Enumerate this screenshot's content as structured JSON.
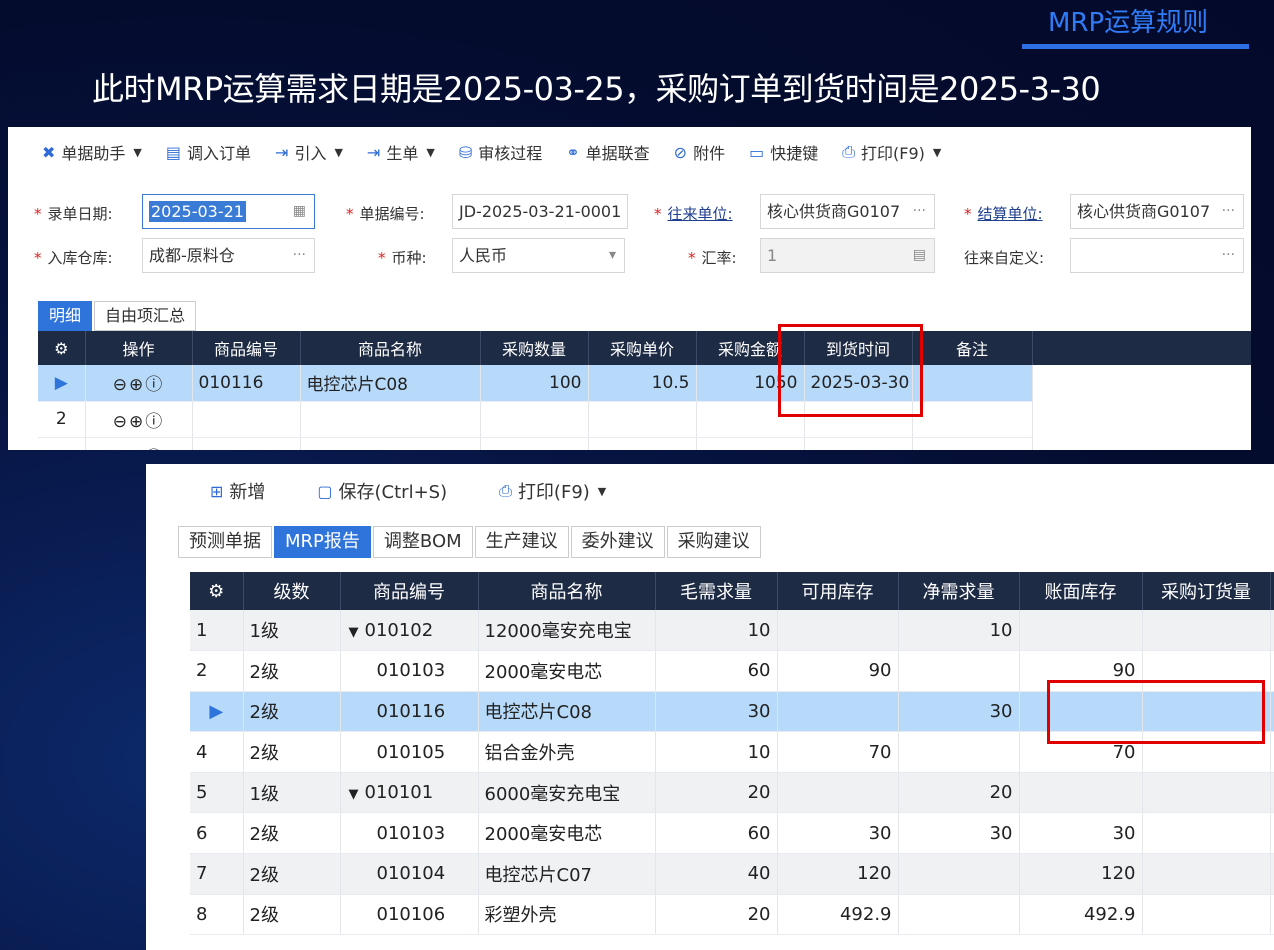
{
  "slide": {
    "title": "MRP运算规则",
    "subtitle": "此时MRP运算需求日期是2025-03-25，采购订单到货时间是2025-3-30"
  },
  "order_form": {
    "toolbar": [
      {
        "label": "单据助手",
        "icon": "✖",
        "caret": true
      },
      {
        "label": "调入订单",
        "icon": "▤",
        "caret": false
      },
      {
        "label": "引入",
        "icon": "⇥",
        "caret": true
      },
      {
        "label": "生单",
        "icon": "⇥",
        "caret": true
      },
      {
        "label": "审核过程",
        "icon": "⛁",
        "caret": false
      },
      {
        "label": "单据联查",
        "icon": "⚭",
        "caret": false
      },
      {
        "label": "附件",
        "icon": "⊘",
        "caret": false
      },
      {
        "label": "快捷键",
        "icon": "▭",
        "caret": false
      },
      {
        "label": "打印(F9)",
        "icon": "⎙",
        "caret": true
      }
    ],
    "fields": {
      "entry_date_label": "录单日期:",
      "entry_date_value": "2025-03-21",
      "doc_no_label": "单据编号:",
      "doc_no_value": "JD-2025-03-21-0001",
      "partner_label": "往来单位:",
      "partner_value": "核心供货商G0107",
      "settle_label": "结算单位:",
      "settle_value": "核心供货商G0107",
      "warehouse_label": "入库仓库:",
      "warehouse_value": "成都-原料仓",
      "currency_label": "币种:",
      "currency_value": "人民币",
      "rate_label": "汇率:",
      "rate_value": "1",
      "custom_label": "往来自定义:",
      "custom_value": ""
    },
    "tabs": [
      "明细",
      "自由项汇总"
    ],
    "columns": [
      "操作",
      "商品编号",
      "商品名称",
      "采购数量",
      "采购单价",
      "采购金额",
      "到货时间",
      "备注"
    ],
    "rows": [
      {
        "idx": "▶",
        "ops": "⊖⊕ⓘ",
        "code": "010116",
        "name": "电控芯片C08",
        "qty": "100",
        "price": "10.5",
        "amount": "1050",
        "arrival": "2025-03-30",
        "note": ""
      },
      {
        "idx": "2",
        "ops": "⊖⊕ⓘ",
        "code": "",
        "name": "",
        "qty": "",
        "price": "",
        "amount": "",
        "arrival": "",
        "note": ""
      },
      {
        "idx": "",
        "ops": "⊖⊕ⓘ",
        "code": "",
        "name": "",
        "qty": "",
        "price": "",
        "amount": "",
        "arrival": "",
        "note": ""
      }
    ]
  },
  "mrp": {
    "toolbar": [
      {
        "label": "新增",
        "icon": "⊞",
        "caret": false
      },
      {
        "label": "保存(Ctrl+S)",
        "icon": "▢",
        "caret": false
      },
      {
        "label": "打印(F9)",
        "icon": "⎙",
        "caret": true
      }
    ],
    "tabs": [
      "预测单据",
      "MRP报告",
      "调整BOM",
      "生产建议",
      "委外建议",
      "采购建议"
    ],
    "active_tab": 1,
    "columns": [
      "级数",
      "商品编号",
      "商品名称",
      "毛需求量",
      "可用库存",
      "净需求量",
      "账面库存",
      "采购订货量"
    ],
    "rows": [
      {
        "idx": "1",
        "level": "1级",
        "expand": "▼",
        "code": "010102",
        "name": "12000毫安充电宝",
        "gross": "10",
        "avail": "",
        "net": "10",
        "book": "",
        "po": ""
      },
      {
        "idx": "2",
        "level": "2级",
        "expand": "",
        "code": "010103",
        "name": "2000毫安电芯",
        "gross": "60",
        "avail": "90",
        "net": "",
        "book": "90",
        "po": ""
      },
      {
        "idx": "▶",
        "level": "2级",
        "expand": "",
        "code": "010116",
        "name": "电控芯片C08",
        "gross": "30",
        "avail": "",
        "net": "30",
        "book": "",
        "po": ""
      },
      {
        "idx": "4",
        "level": "2级",
        "expand": "",
        "code": "010105",
        "name": "铝合金外壳",
        "gross": "10",
        "avail": "70",
        "net": "",
        "book": "70",
        "po": ""
      },
      {
        "idx": "5",
        "level": "1级",
        "expand": "▼",
        "code": "010101",
        "name": "6000毫安充电宝",
        "gross": "20",
        "avail": "",
        "net": "20",
        "book": "",
        "po": ""
      },
      {
        "idx": "6",
        "level": "2级",
        "expand": "",
        "code": "010103",
        "name": "2000毫安电芯",
        "gross": "60",
        "avail": "30",
        "net": "30",
        "book": "30",
        "po": ""
      },
      {
        "idx": "7",
        "level": "2级",
        "expand": "",
        "code": "010104",
        "name": "电控芯片C07",
        "gross": "40",
        "avail": "120",
        "net": "",
        "book": "120",
        "po": ""
      },
      {
        "idx": "8",
        "level": "2级",
        "expand": "",
        "code": "010106",
        "name": "彩塑外壳",
        "gross": "20",
        "avail": "492.9",
        "net": "",
        "book": "492.9",
        "po": ""
      }
    ]
  }
}
